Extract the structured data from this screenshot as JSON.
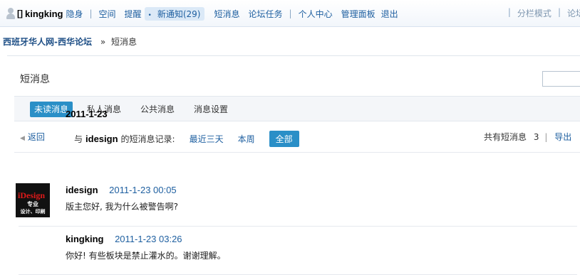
{
  "topbar": {
    "username": "kingking",
    "bracket": "[]",
    "invisible": "隐身",
    "items": [
      "空间",
      "提醒"
    ],
    "notice": "新通知(29)",
    "items2": [
      "短消息",
      "论坛任务"
    ],
    "items3": [
      "个人中心",
      "管理面板",
      "退出"
    ],
    "right": [
      "分栏模式",
      "论坛"
    ]
  },
  "breadcrumb": {
    "home": "西班牙华人网-西华论坛",
    "arrow": "»",
    "current": "短消息"
  },
  "panel": {
    "title": "短消息",
    "search_value": "",
    "tabs": [
      "未读消息",
      "私人消息",
      "公共消息",
      "消息设置"
    ],
    "active_tab": "未读消息"
  },
  "filter": {
    "back": "返回",
    "prefix": "与",
    "who": "idesign",
    "suffix": "的短消息记录:",
    "ranges": [
      "最近三天",
      "本周"
    ],
    "active_range": "全部",
    "total_label": "共有短消息",
    "total": "3",
    "separator": "|",
    "export": "导出"
  },
  "thread": {
    "date": "2011-1-23",
    "messages": [
      {
        "sender": "idesign",
        "time": "2011-1-23 00:05",
        "text": "版主您好, 我为什么被警告啊?",
        "avatar_logo": "iDesign",
        "avatar_line2": "专业",
        "avatar_line3": "设计、印刷"
      },
      {
        "sender": "kingking",
        "time": "2011-1-23 03:26",
        "text": "你好! 有些板块是禁止灌水的。谢谢理解。"
      }
    ]
  },
  "colors": {
    "accent": "#2a8fc7",
    "link": "#1e5fa0",
    "topbar_bg": "#f2f6fb"
  }
}
